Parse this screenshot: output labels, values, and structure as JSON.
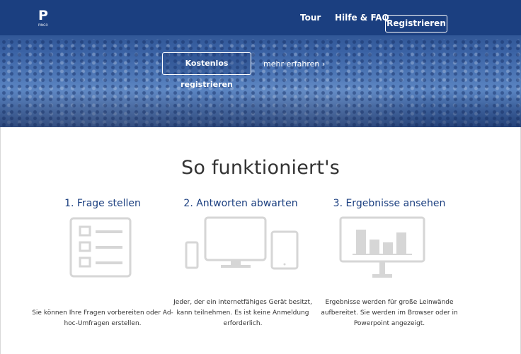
{
  "header": {
    "logo_letter": "P",
    "logo_subtext": "PINGO",
    "nav": {
      "tour": "Tour",
      "help": "Hilfe & FAQ",
      "register": "Registrieren"
    }
  },
  "hero": {
    "cta_label": "Kostenlos registrieren",
    "more_link": "mehr erfahren ›"
  },
  "main": {
    "title": "So funktioniert's",
    "steps": [
      {
        "title": "1. Frage stellen",
        "text": "Sie können Ihre Fragen vorbereiten oder Ad-hoc-Umfragen erstellen.",
        "icon": "question-list-icon"
      },
      {
        "title": "2. Antworten abwarten",
        "text": "Jeder, der ein internetfähiges Gerät besitzt, kann teilnehmen. Es ist keine Anmeldung erforderlich.",
        "icon": "devices-icon"
      },
      {
        "title": "3. Ergebnisse ansehen",
        "text": "Ergebnisse werden für große Leinwände aufbereitet. Sie werden im Browser oder in Powerpoint angezeigt.",
        "icon": "results-chart-icon"
      }
    ]
  },
  "colors": {
    "brand_blue": "#1b3f80",
    "icon_gray": "#d6d6d6",
    "text": "#333333"
  }
}
